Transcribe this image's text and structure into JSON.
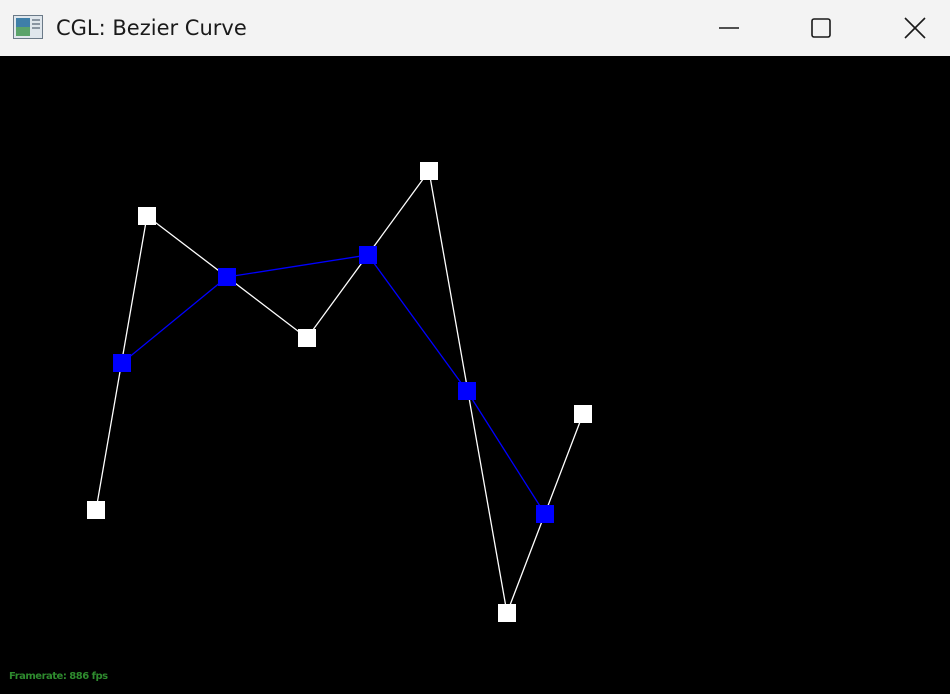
{
  "window": {
    "title": "CGL: Bezier Curve",
    "icon": "app-window-icon",
    "controls": [
      "minimize-icon",
      "maximize-icon",
      "close-icon"
    ]
  },
  "scene": {
    "background": "#000000",
    "control_polygon_color": "#ffffff",
    "derived_polygon_color": "#0000ff"
  },
  "status": {
    "framerate": "Framerate: 886 fps",
    "color": "#2e8b2e"
  }
}
